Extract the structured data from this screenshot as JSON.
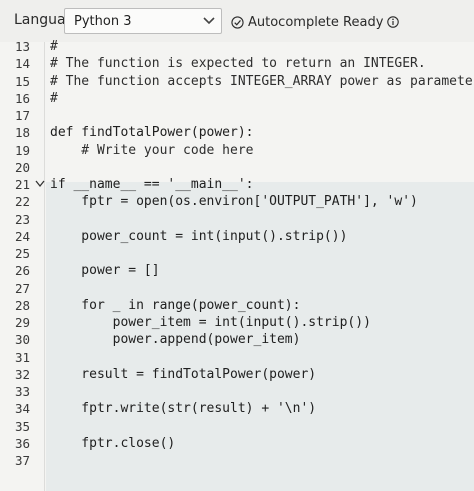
{
  "toolbar": {
    "language_label": "Language",
    "language_value": "Python 3",
    "status_text": "Autocomplete Ready"
  },
  "editor": {
    "lines": [
      {
        "n": "13",
        "t": "#",
        "cls": "cm"
      },
      {
        "n": "14",
        "t": "# The function is expected to return an INTEGER.",
        "cls": "cm"
      },
      {
        "n": "15",
        "t": "# The function accepts INTEGER_ARRAY power as parameter.",
        "cls": "cm"
      },
      {
        "n": "16",
        "t": "#",
        "cls": "cm"
      },
      {
        "n": "17",
        "t": "",
        "cls": ""
      },
      {
        "n": "18",
        "t": "def findTotalPower(power):",
        "cls": ""
      },
      {
        "n": "19",
        "t": "    # Write your code here",
        "cls": "cm"
      },
      {
        "n": "20",
        "t": "",
        "cls": ""
      },
      {
        "n": "21",
        "t": "if __name__ == '__main__':",
        "cls": ""
      },
      {
        "n": "22",
        "t": "    fptr = open(os.environ['OUTPUT_PATH'], 'w')",
        "cls": ""
      },
      {
        "n": "23",
        "t": "",
        "cls": ""
      },
      {
        "n": "24",
        "t": "    power_count = int(input().strip())",
        "cls": ""
      },
      {
        "n": "25",
        "t": "",
        "cls": ""
      },
      {
        "n": "26",
        "t": "    power = []",
        "cls": ""
      },
      {
        "n": "27",
        "t": "",
        "cls": ""
      },
      {
        "n": "28",
        "t": "    for _ in range(power_count):",
        "cls": ""
      },
      {
        "n": "29",
        "t": "        power_item = int(input().strip())",
        "cls": ""
      },
      {
        "n": "30",
        "t": "        power.append(power_item)",
        "cls": ""
      },
      {
        "n": "31",
        "t": "",
        "cls": ""
      },
      {
        "n": "32",
        "t": "    result = findTotalPower(power)",
        "cls": ""
      },
      {
        "n": "33",
        "t": "",
        "cls": ""
      },
      {
        "n": "34",
        "t": "    fptr.write(str(result) + '\\n')",
        "cls": ""
      },
      {
        "n": "35",
        "t": "",
        "cls": ""
      },
      {
        "n": "36",
        "t": "    fptr.close()",
        "cls": ""
      },
      {
        "n": "37",
        "t": "",
        "cls": ""
      }
    ]
  },
  "icons": {
    "check": "check-circle-icon",
    "info": "info-icon",
    "chevron": "chevron-down-icon",
    "fold": "fold-chevron-icon"
  },
  "colors": {
    "keyword": "#1a2fa8",
    "string": "#a3151a",
    "active_block": "#e7ebeb"
  }
}
